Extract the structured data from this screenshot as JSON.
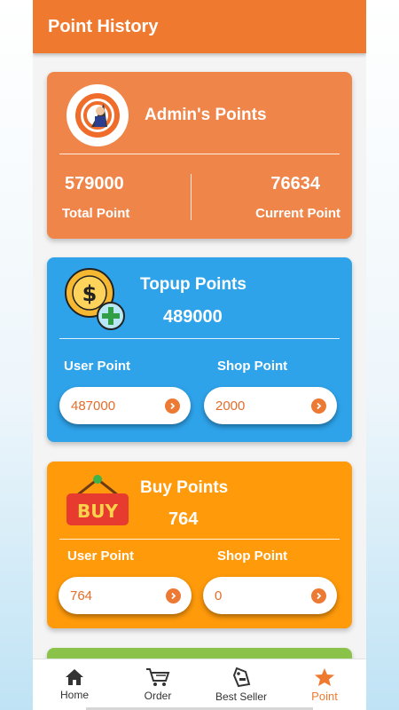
{
  "appbar": {
    "title": "Point History"
  },
  "admin": {
    "title": "Admin's Points",
    "total_value": "579000",
    "total_label": "Total Point",
    "current_value": "76634",
    "current_label": "Current Point"
  },
  "topup": {
    "title": "Topup Points",
    "total": "489000",
    "user_label": "User Point",
    "shop_label": "Shop Point",
    "user_value": "487000",
    "shop_value": "2000"
  },
  "buy": {
    "title": "Buy Points",
    "badge_text": "BUY",
    "total": "764",
    "user_label": "User Point",
    "shop_label": "Shop Point",
    "user_value": "764",
    "shop_value": "0"
  },
  "nav": {
    "items": [
      {
        "label": "Home",
        "icon": "home-icon"
      },
      {
        "label": "Order",
        "icon": "cart-icon"
      },
      {
        "label": "Best Seller",
        "icon": "tag-icon"
      },
      {
        "label": "Point",
        "icon": "star-icon"
      }
    ],
    "active": "Point"
  },
  "colors": {
    "appbar": "#ef7a2f",
    "admin_card": "#f0854a",
    "topup_card": "#2ea3ea",
    "buy_card": "#ff9a0b",
    "green_card": "#8bc34a"
  }
}
